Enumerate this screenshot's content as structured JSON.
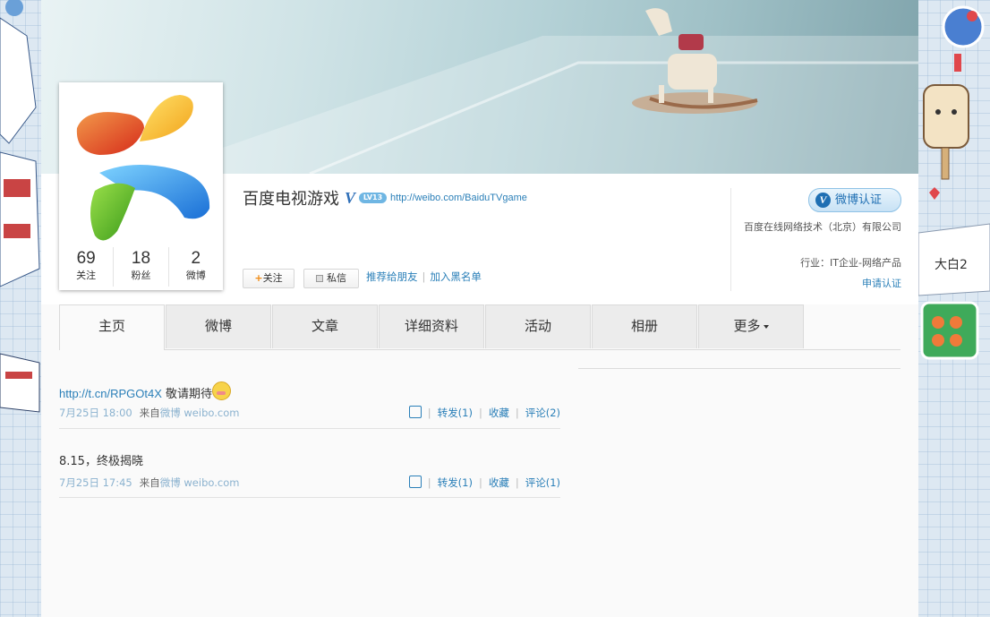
{
  "profile": {
    "name": "百度电视游戏",
    "verified_mark": "V",
    "level_badge": "LV13",
    "homepage": "http://weibo.com/BaiduTVgame",
    "stats": [
      {
        "num": "69",
        "label": "关注"
      },
      {
        "num": "18",
        "label": "粉丝"
      },
      {
        "num": "2",
        "label": "微博"
      }
    ]
  },
  "actions": {
    "follow": "关注",
    "follow_plus": "+",
    "message": "私信",
    "recommend": "推荐给朋友",
    "separator": "|",
    "blacklist": "加入黑名单"
  },
  "verify": {
    "badge_v": "V",
    "badge_label": "微博认证",
    "company": "百度在线网络技术（北京）有限公司",
    "industry": "行业：IT企业-网络产品",
    "apply": "申请认证"
  },
  "tabs": [
    "主页",
    "微博",
    "文章",
    "详细资料",
    "活动",
    "相册",
    "更多"
  ],
  "feed": [
    {
      "link": "http://t.cn/RPGOt4X",
      "text": " 敬请期待",
      "time": "7月25日 18:00",
      "from_label": "来自",
      "source": "微博 weibo.com",
      "repost": "转发(1)",
      "favorite": "收藏",
      "comment": "评论(2)"
    },
    {
      "text": "8.15，终极揭晓",
      "time": "7月25日 17:45",
      "from_label": "来自",
      "source": "微博 weibo.com",
      "repost": "转发(1)",
      "favorite": "收藏",
      "comment": "评论(1)"
    }
  ],
  "colors": {
    "link": "#2a7fb8",
    "accent_orange": "#f08b14",
    "verify_blue": "#1f6fb3"
  }
}
